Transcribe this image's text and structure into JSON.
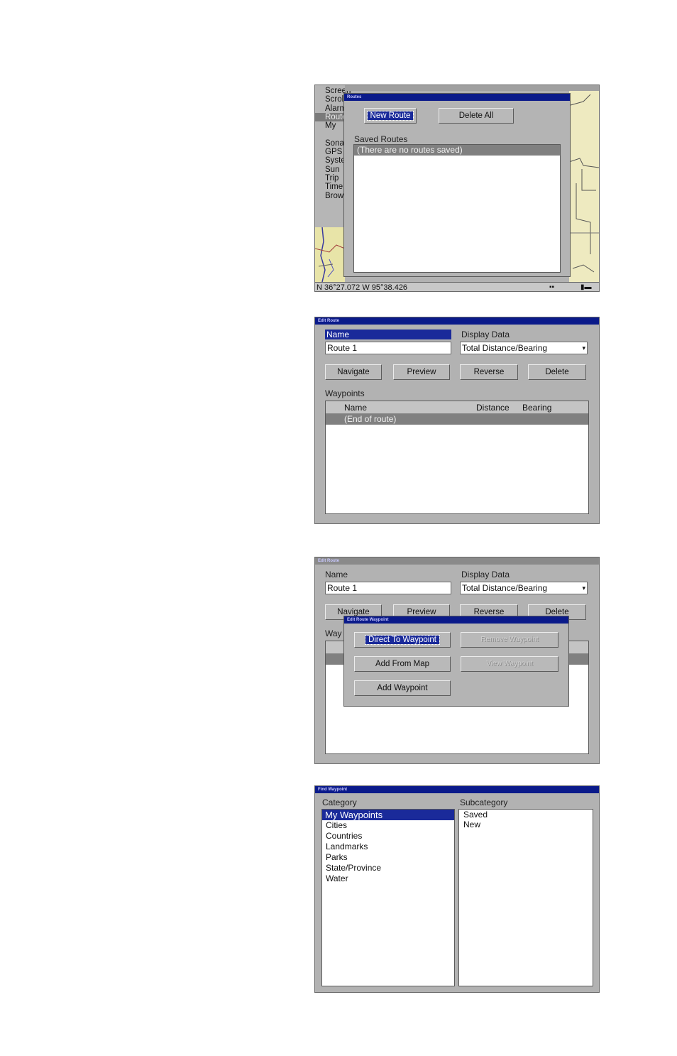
{
  "screen1": {
    "status_bar": "N  36°27.072  W  95°38.426",
    "menu_items": [
      "Screen",
      "Scroll",
      "Alarms",
      "Routes",
      "My",
      "",
      "Sonar",
      "GPS",
      "System",
      "Sun",
      "Trip",
      "Time",
      "Browse"
    ],
    "dialog": {
      "title": "Routes",
      "new_route": "New Route",
      "delete_all": "Delete All",
      "saved_routes_label": "Saved Routes",
      "no_routes_msg": "(There are no routes saved)"
    }
  },
  "edit_route": {
    "title": "Edit Route",
    "name_label": "Name",
    "name_value": "Route 1",
    "display_data_label": "Display Data",
    "display_data_value": "Total Distance/Bearing",
    "buttons": {
      "navigate": "Navigate",
      "preview": "Preview",
      "reverse": "Reverse",
      "delete": "Delete"
    },
    "waypoints_label": "Waypoints",
    "col_name": "Name",
    "col_distance": "Distance",
    "col_bearing": "Bearing",
    "end_of_route": "(End of route)"
  },
  "edit_route_waypoint": {
    "title": "Edit Route",
    "popup_title": "Edit Route Waypoint",
    "name_label": "Name",
    "name_value": "Route 1",
    "display_data_label": "Display Data",
    "display_data_value": "Total Distance/Bearing",
    "buttons": {
      "navigate": "Navigate",
      "preview": "Preview",
      "reverse": "Reverse",
      "delete": "Delete"
    },
    "waypoints_label": "Way",
    "direct_to_waypoint": "Direct To Waypoint",
    "remove_waypoint": "Remove Waypoint",
    "add_from_map": "Add From Map",
    "view_waypoint": "View Waypoint",
    "add_waypoint": "Add Waypoint"
  },
  "find_waypoint": {
    "title": "Find Waypoint",
    "category_label": "Category",
    "subcategory_label": "Subcategory",
    "categories": [
      "My Waypoints",
      "Cities",
      "Countries",
      "Landmarks",
      "Parks",
      "State/Province",
      "Water"
    ],
    "subcategories": [
      "Saved",
      "New"
    ]
  }
}
